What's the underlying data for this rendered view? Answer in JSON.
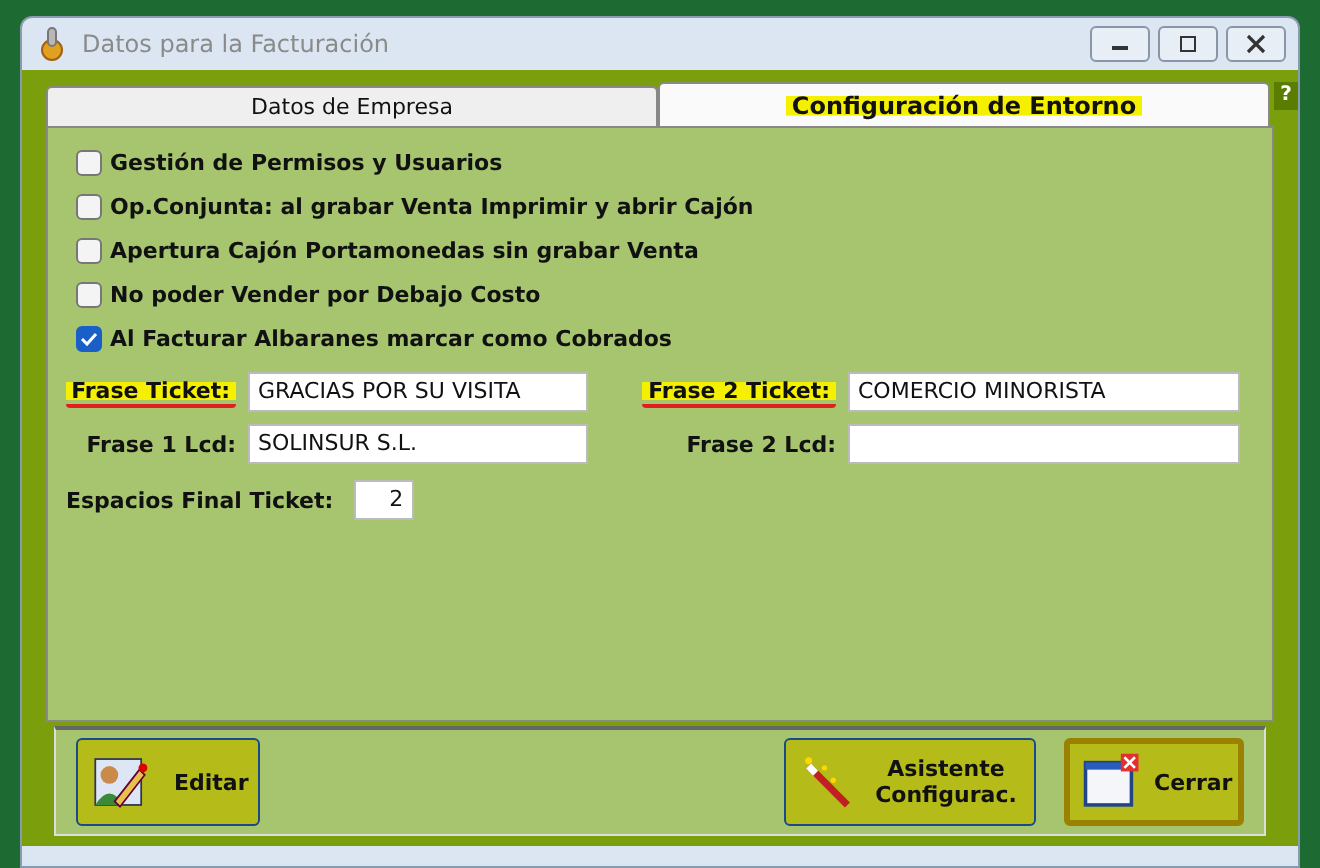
{
  "window": {
    "title": "Datos para la Facturación"
  },
  "tabs": [
    {
      "label": "Datos de Empresa",
      "selected": false,
      "highlighted": false
    },
    {
      "label": "Configuración de Entorno",
      "selected": true,
      "highlighted": true
    }
  ],
  "options": [
    {
      "label": "Gestión de Permisos y Usuarios",
      "checked": false
    },
    {
      "label": "Op.Conjunta: al grabar Venta Imprimir y abrir Cajón",
      "checked": false
    },
    {
      "label": "Apertura Cajón Portamonedas sin grabar Venta",
      "checked": false
    },
    {
      "label": "No poder Vender por Debajo Costo",
      "checked": false
    },
    {
      "label": "Al Facturar Albaranes marcar como Cobrados",
      "checked": true
    }
  ],
  "fields": [
    {
      "label": "Frase Ticket:",
      "value": "GRACIAS POR SU VISITA",
      "highlighted": true
    },
    {
      "label": "Frase 2 Ticket:",
      "value": "COMERCIO MINORISTA",
      "highlighted": true
    },
    {
      "label": "Frase 1 Lcd:",
      "value": "SOLINSUR S.L.",
      "highlighted": false
    },
    {
      "label": "Frase 2 Lcd:",
      "highlighted": false
    }
  ],
  "help_button": "?",
  "spaces_field": {
    "label": "Espacios Final Ticket:",
    "value": "2"
  },
  "buttons": [
    {
      "kind": "edit",
      "label": "Editar",
      "default": false
    },
    {
      "kind": "wizard",
      "label": "Asistente Configurac.",
      "default": false
    },
    {
      "kind": "close",
      "label": "Cerrar",
      "default": true
    }
  ]
}
